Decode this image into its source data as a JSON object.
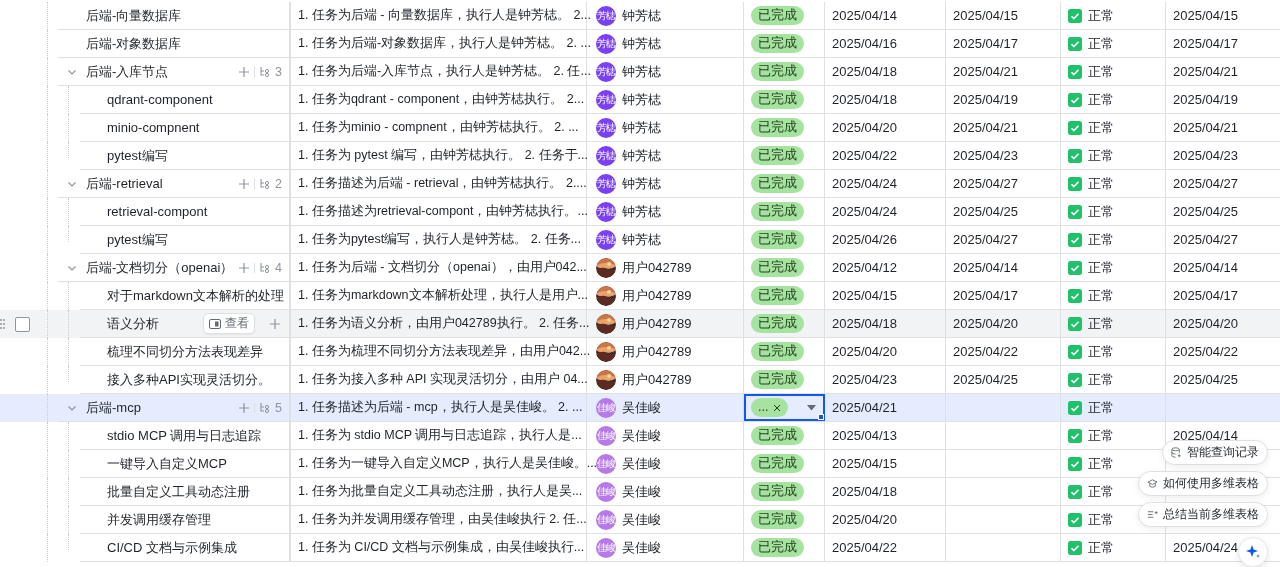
{
  "rows": [
    {
      "name": "后端-向量数据库",
      "selected": false,
      "hovered": false,
      "description": "1. 任务为后端 - 向量数据库，执行人是钟芳梽。 2...",
      "assignee": {
        "name": "钟芳梽",
        "avatar": {
          "kind": "initials",
          "text": "芳梽",
          "color": "#7b3ff2"
        }
      },
      "status": {
        "text": "已完成",
        "editing": false
      },
      "start": "2025/04/14",
      "end": "2025/04/15",
      "normal": {
        "checked": true,
        "label": "正常"
      },
      "last": "2025/04/15"
    },
    {
      "name": "后端-对象数据库",
      "selected": false,
      "hovered": false,
      "description": "1. 任务为后端-对象数据库，执行人是钟芳梽。 2. ...",
      "assignee": {
        "name": "钟芳梽",
        "avatar": {
          "kind": "initials",
          "text": "芳梽",
          "color": "#7b3ff2"
        }
      },
      "status": {
        "text": "已完成",
        "editing": false
      },
      "start": "2025/04/16",
      "end": "2025/04/17",
      "normal": {
        "checked": true,
        "label": "正常"
      },
      "last": "2025/04/17"
    },
    {
      "name": "后端-入库节点",
      "selected": false,
      "hovered": false,
      "expanded": true,
      "child_count": "3",
      "description": "1. 任务为后端-入库节点，执行人是钟芳梽。 2. 任...",
      "assignee": {
        "name": "钟芳梽",
        "avatar": {
          "kind": "initials",
          "text": "芳梽",
          "color": "#7b3ff2"
        }
      },
      "status": {
        "text": "已完成",
        "editing": false
      },
      "start": "2025/04/18",
      "end": "2025/04/21",
      "normal": {
        "checked": true,
        "label": "正常"
      },
      "last": "2025/04/21",
      "children": [
        {
          "name": "qdrant-component",
          "selected": false,
          "hovered": false,
          "description": "1. 任务为qdrant - component，由钟芳梽执行。 2...",
          "assignee": {
            "name": "钟芳梽",
            "avatar": {
              "kind": "initials",
              "text": "芳梽",
              "color": "#7b3ff2"
            }
          },
          "status": {
            "text": "已完成",
            "editing": false
          },
          "start": "2025/04/18",
          "end": "2025/04/19",
          "normal": {
            "checked": true,
            "label": "正常"
          },
          "last": "2025/04/19"
        },
        {
          "name": "minio-compnent",
          "selected": false,
          "hovered": false,
          "description": "1. 任务为minio - compnent，由钟芳梽执行。 2. ...",
          "assignee": {
            "name": "钟芳梽",
            "avatar": {
              "kind": "initials",
              "text": "芳梽",
              "color": "#7b3ff2"
            }
          },
          "status": {
            "text": "已完成",
            "editing": false
          },
          "start": "2025/04/20",
          "end": "2025/04/21",
          "normal": {
            "checked": true,
            "label": "正常"
          },
          "last": "2025/04/21"
        },
        {
          "name": "pytest编写",
          "selected": false,
          "hovered": false,
          "description": "1. 任务为 pytest 编写，由钟芳梽执行。 2. 任务于...",
          "assignee": {
            "name": "钟芳梽",
            "avatar": {
              "kind": "initials",
              "text": "芳梽",
              "color": "#7b3ff2"
            }
          },
          "status": {
            "text": "已完成",
            "editing": false
          },
          "start": "2025/04/22",
          "end": "2025/04/23",
          "normal": {
            "checked": true,
            "label": "正常"
          },
          "last": "2025/04/23"
        }
      ]
    },
    {
      "name": "后端-retrieval",
      "selected": false,
      "hovered": false,
      "expanded": true,
      "child_count": "2",
      "description": "1. 任务描述为后端 - retrieval，由钟芳梽执行。 2....",
      "assignee": {
        "name": "钟芳梽",
        "avatar": {
          "kind": "initials",
          "text": "芳梽",
          "color": "#7b3ff2"
        }
      },
      "status": {
        "text": "已完成",
        "editing": false
      },
      "start": "2025/04/24",
      "end": "2025/04/27",
      "normal": {
        "checked": true,
        "label": "正常"
      },
      "last": "2025/04/27",
      "children": [
        {
          "name": "retrieval-compont",
          "selected": false,
          "hovered": false,
          "description": "1. 任务描述为retrieval-compont，由钟芳梽执行。...",
          "assignee": {
            "name": "钟芳梽",
            "avatar": {
              "kind": "initials",
              "text": "芳梽",
              "color": "#7b3ff2"
            }
          },
          "status": {
            "text": "已完成",
            "editing": false
          },
          "start": "2025/04/24",
          "end": "2025/04/25",
          "normal": {
            "checked": true,
            "label": "正常"
          },
          "last": "2025/04/25"
        },
        {
          "name": "pytest编写",
          "selected": false,
          "hovered": false,
          "description": "1. 任务为pytest编写，执行人是钟芳梽。 2. 任务...",
          "assignee": {
            "name": "钟芳梽",
            "avatar": {
              "kind": "initials",
              "text": "芳梽",
              "color": "#7b3ff2"
            }
          },
          "status": {
            "text": "已完成",
            "editing": false
          },
          "start": "2025/04/26",
          "end": "2025/04/27",
          "normal": {
            "checked": true,
            "label": "正常"
          },
          "last": "2025/04/27"
        }
      ]
    },
    {
      "name": "后端-文档切分（openai）",
      "selected": false,
      "hovered": false,
      "expanded": true,
      "child_count": "4",
      "description": "1. 任务为后端 - 文档切分（openai），由用户042...",
      "assignee": {
        "name": "用户042789"
      },
      "status": {
        "text": "已完成",
        "editing": false
      },
      "start": "2025/04/12",
      "end": "2025/04/14",
      "normal": {
        "checked": true,
        "label": "正常"
      },
      "last": "2025/04/14",
      "children": [
        {
          "name": "对于markdown文本解析的处理",
          "selected": false,
          "hovered": false,
          "description": "1. 任务为markdown文本解析处理，执行人是用户...",
          "assignee": {
            "name": "用户042789"
          },
          "status": {
            "text": "已完成",
            "editing": false
          },
          "start": "2025/04/15",
          "end": "2025/04/17",
          "normal": {
            "checked": true,
            "label": "正常"
          },
          "last": "2025/04/17"
        },
        {
          "name": "语义分析",
          "selected": false,
          "hovered": true,
          "view_label": "查看",
          "description": "1. 任务为语义分析，由用户042789执行。 2. 任务...",
          "assignee": {
            "name": "用户042789"
          },
          "status": {
            "text": "已完成",
            "editing": false
          },
          "start": "2025/04/18",
          "end": "2025/04/20",
          "normal": {
            "checked": true,
            "label": "正常"
          },
          "last": "2025/04/20"
        },
        {
          "name": "梳理不同切分方法表现差异",
          "selected": false,
          "hovered": false,
          "description": "1. 任务为梳理不同切分方法表现差异，由用户042...",
          "assignee": {
            "name": "用户042789"
          },
          "status": {
            "text": "已完成",
            "editing": false
          },
          "start": "2025/04/20",
          "end": "2025/04/22",
          "normal": {
            "checked": true,
            "label": "正常"
          },
          "last": "2025/04/22"
        },
        {
          "name": "接入多种API实现灵活切分。",
          "selected": false,
          "hovered": false,
          "description": "1. 任务为接入多种 API 实现灵活切分，由用户 04...",
          "assignee": {
            "name": "用户042789"
          },
          "status": {
            "text": "已完成",
            "editing": false
          },
          "start": "2025/04/23",
          "end": "2025/04/25",
          "normal": {
            "checked": true,
            "label": "正常"
          },
          "last": "2025/04/25"
        }
      ]
    },
    {
      "name": "后端-mcp",
      "selected": true,
      "hovered": false,
      "expanded": true,
      "child_count": "5",
      "description": "1. 任务描述为后端 - mcp，执行人是吴佳峻。 2. ...",
      "assignee": {
        "name": "吴佳峻",
        "avatar": {
          "kind": "initials",
          "text": "佳峻",
          "color": "#b67ae6"
        }
      },
      "status": {
        "text": "...",
        "editing": true
      },
      "start": "2025/04/21",
      "normal": {
        "checked": true,
        "label": "正常"
      },
      "children": [
        {
          "name": "stdio MCP 调用与日志追踪",
          "selected": false,
          "hovered": false,
          "description": "1. 任务为 stdio MCP 调用与日志追踪，执行人是...",
          "assignee": {
            "name": "吴佳峻",
            "avatar": {
              "kind": "initials",
              "text": "佳峻",
              "color": "#b67ae6"
            }
          },
          "status": {
            "text": "已完成",
            "editing": false
          },
          "start": "2025/04/13",
          "normal": {
            "checked": true,
            "label": "正常"
          },
          "last": "2025/04/14"
        },
        {
          "name": "一键导入自定义MCP",
          "selected": false,
          "hovered": false,
          "description": "1. 任务为一键导入自定义MCP，执行人是吴佳峻。...",
          "assignee": {
            "name": "吴佳峻",
            "avatar": {
              "kind": "initials",
              "text": "佳峻",
              "color": "#b67ae6"
            }
          },
          "status": {
            "text": "已完成",
            "editing": false
          },
          "start": "2025/04/15",
          "normal": {
            "checked": true,
            "label": "正常"
          }
        },
        {
          "name": "批量自定义工具动态注册",
          "selected": false,
          "hovered": false,
          "description": "1. 任务为批量自定义工具动态注册，执行人是吴...",
          "assignee": {
            "name": "吴佳峻",
            "avatar": {
              "kind": "initials",
              "text": "佳峻",
              "color": "#b67ae6"
            }
          },
          "status": {
            "text": "已完成",
            "editing": false
          },
          "start": "2025/04/18",
          "normal": {
            "checked": true,
            "label": "正常"
          }
        },
        {
          "name": "并发调用缓存管理",
          "selected": false,
          "hovered": false,
          "description": "1. 任务为并发调用缓存管理，由吴佳峻执行 2. 任...",
          "assignee": {
            "name": "吴佳峻",
            "avatar": {
              "kind": "initials",
              "text": "佳峻",
              "color": "#b67ae6"
            }
          },
          "status": {
            "text": "已完成",
            "editing": false
          },
          "start": "2025/04/20",
          "normal": {
            "checked": true,
            "label": "正常"
          }
        },
        {
          "name": "CI/CD 文档与示例集成",
          "selected": false,
          "hovered": false,
          "description": "1. 任务为 CI/CD 文档与示例集成，由吴佳峻执行...",
          "assignee": {
            "name": "吴佳峻",
            "avatar": {
              "kind": "initials",
              "text": "佳峻",
              "color": "#b67ae6"
            }
          },
          "status": {
            "text": "已完成",
            "editing": false
          },
          "start": "2025/04/22",
          "normal": {
            "checked": true,
            "label": "正常"
          },
          "last": "2025/04/24"
        }
      ]
    }
  ],
  "assistant": {
    "suggestions": [
      "智能查询记录",
      "如何使用多维表格",
      "总结当前多维表格"
    ]
  }
}
